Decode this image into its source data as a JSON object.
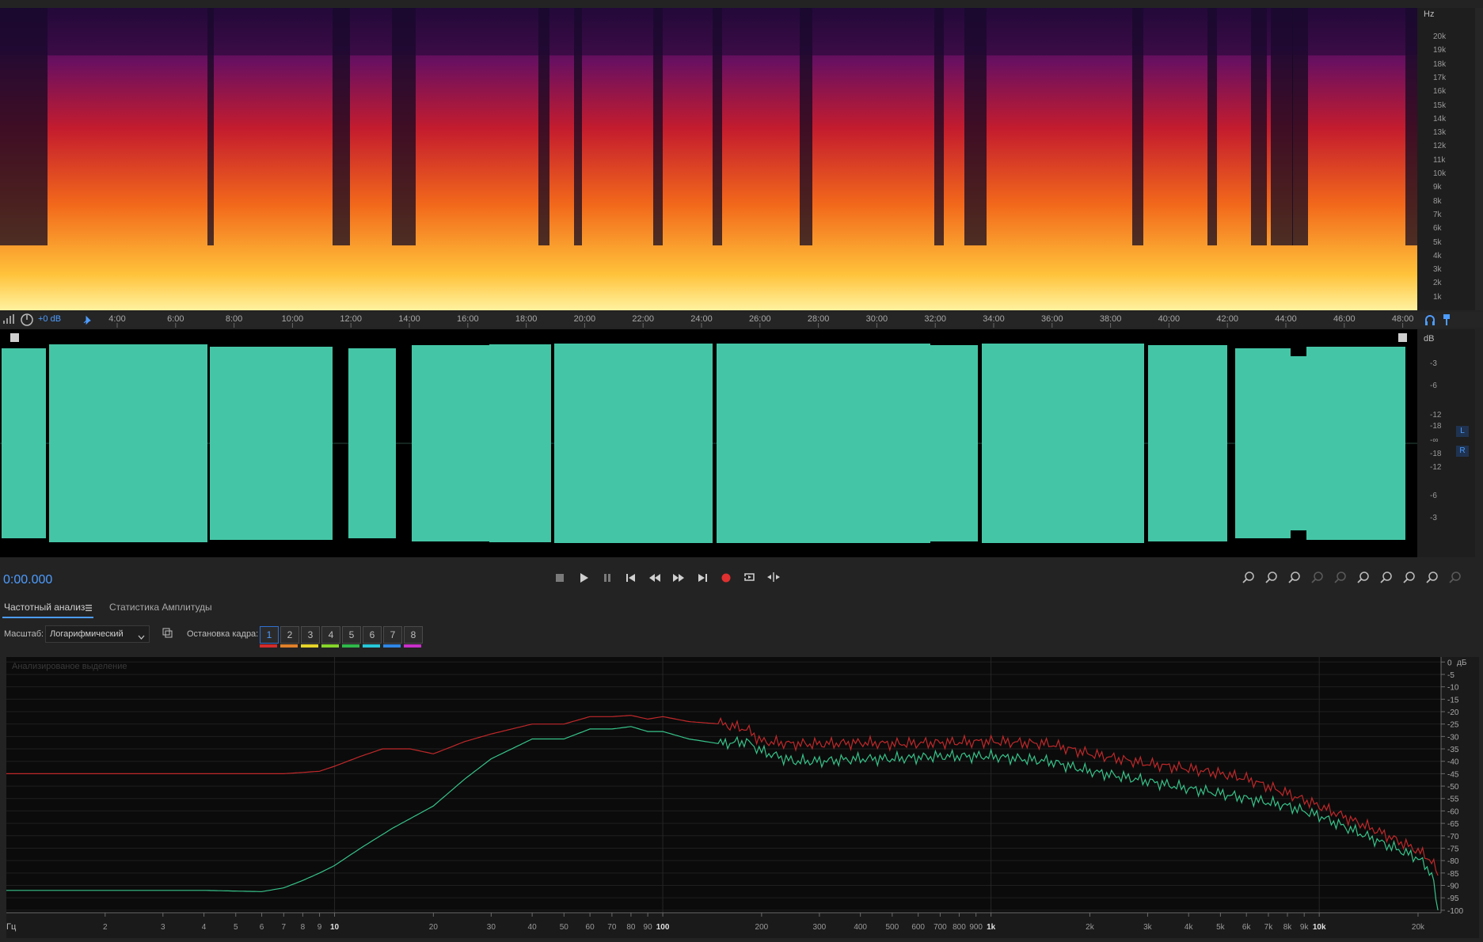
{
  "colors": {
    "waveform": "#44c6a6",
    "analysis_red": "#c0282a",
    "analysis_green": "#37c38a",
    "accent_blue": "#3a8ee6",
    "record_red": "#e03030"
  },
  "spectrogram": {
    "hz_unit": "Hz",
    "freq_labels": [
      "20k",
      "19k",
      "18k",
      "17k",
      "16k",
      "15k",
      "14k",
      "13k",
      "12k",
      "11k",
      "10k",
      "9k",
      "8k",
      "7k",
      "6k",
      "5k",
      "4k",
      "3k",
      "2k",
      "1k"
    ]
  },
  "timeline": {
    "gain_label": "+0 dB",
    "ticks": [
      "4:00",
      "6:00",
      "8:00",
      "10:00",
      "12:00",
      "14:00",
      "16:00",
      "18:00",
      "20:00",
      "22:00",
      "24:00",
      "26:00",
      "28:00",
      "30:00",
      "32:00",
      "34:00",
      "36:00",
      "38:00",
      "40:00",
      "42:00",
      "44:00",
      "46:00",
      "48:00"
    ]
  },
  "waveform": {
    "db_unit": "dB",
    "db_labels": [
      "-3",
      "-6",
      "-12",
      "-18",
      "-∞",
      "-18",
      "-12",
      "-6",
      "-3"
    ],
    "channel_left": "L",
    "channel_right": "R"
  },
  "transport": {
    "time": "0:00.000",
    "buttons": [
      "stop-icon",
      "play-icon",
      "pause-icon",
      "skip-start-icon",
      "rewind-icon",
      "fast-forward-icon",
      "skip-end-icon",
      "record-icon",
      "loop-icon",
      "skip-selection-icon"
    ]
  },
  "panel": {
    "tabs": [
      {
        "label": "Частотный анализ",
        "active": true
      },
      {
        "label": "Статистика Амплитуды",
        "active": false
      }
    ],
    "scale_label": "Масштаб:",
    "scale_value": "Логарифмический",
    "freeze_label": "Остановка кадра:",
    "frames": [
      {
        "label": "1",
        "color": "#d42b2b"
      },
      {
        "label": "2",
        "color": "#e0802a"
      },
      {
        "label": "3",
        "color": "#e6d42a"
      },
      {
        "label": "4",
        "color": "#86d52b"
      },
      {
        "label": "5",
        "color": "#2fb84a"
      },
      {
        "label": "6",
        "color": "#27c8d8"
      },
      {
        "label": "7",
        "color": "#2f86e6"
      },
      {
        "label": "8",
        "color": "#c72fc8"
      }
    ]
  },
  "analysis": {
    "overlay_label": "Анализированое выделение",
    "db_unit": "дБ",
    "db_labels": [
      "0",
      "-5",
      "-10",
      "-15",
      "-20",
      "-25",
      "-30",
      "-35",
      "-40",
      "-45",
      "-50",
      "-55",
      "-60",
      "-65",
      "-70",
      "-75",
      "-80",
      "-85",
      "-90",
      "-95",
      "-100"
    ],
    "hz_unit": "Гц",
    "freq_labels": [
      {
        "f": 2,
        "t": "2"
      },
      {
        "f": 3,
        "t": "3"
      },
      {
        "f": 4,
        "t": "4"
      },
      {
        "f": 5,
        "t": "5"
      },
      {
        "f": 6,
        "t": "6"
      },
      {
        "f": 7,
        "t": "7"
      },
      {
        "f": 8,
        "t": "8"
      },
      {
        "f": 9,
        "t": "9"
      },
      {
        "f": 10,
        "t": "10"
      },
      {
        "f": 20,
        "t": "20"
      },
      {
        "f": 30,
        "t": "30"
      },
      {
        "f": 40,
        "t": "40"
      },
      {
        "f": 50,
        "t": "50"
      },
      {
        "f": 60,
        "t": "60"
      },
      {
        "f": 70,
        "t": "70"
      },
      {
        "f": 80,
        "t": "80"
      },
      {
        "f": 90,
        "t": "90"
      },
      {
        "f": 100,
        "t": "100"
      },
      {
        "f": 200,
        "t": "200"
      },
      {
        "f": 300,
        "t": "300"
      },
      {
        "f": 400,
        "t": "400"
      },
      {
        "f": 500,
        "t": "500"
      },
      {
        "f": 600,
        "t": "600"
      },
      {
        "f": 700,
        "t": "700"
      },
      {
        "f": 800,
        "t": "800"
      },
      {
        "f": 900,
        "t": "900"
      },
      {
        "f": 1000,
        "t": "1k"
      },
      {
        "f": 2000,
        "t": "2k"
      },
      {
        "f": 3000,
        "t": "3k"
      },
      {
        "f": 4000,
        "t": "4k"
      },
      {
        "f": 5000,
        "t": "5k"
      },
      {
        "f": 6000,
        "t": "6k"
      },
      {
        "f": 7000,
        "t": "7k"
      },
      {
        "f": 8000,
        "t": "8k"
      },
      {
        "f": 9000,
        "t": "9k"
      },
      {
        "f": 10000,
        "t": "10k"
      },
      {
        "f": 20000,
        "t": "20k"
      }
    ],
    "series": [
      {
        "color": "#c0282a",
        "points": [
          [
            1,
            -45
          ],
          [
            5,
            -45
          ],
          [
            7,
            -45
          ],
          [
            8,
            -44.5
          ],
          [
            9,
            -44
          ],
          [
            10,
            -42
          ],
          [
            12,
            -38
          ],
          [
            14,
            -35
          ],
          [
            17,
            -35
          ],
          [
            20,
            -37
          ],
          [
            25,
            -32
          ],
          [
            30,
            -29
          ],
          [
            40,
            -25
          ],
          [
            50,
            -25
          ],
          [
            60,
            -22
          ],
          [
            70,
            -22
          ],
          [
            80,
            -21.5
          ],
          [
            90,
            -23
          ],
          [
            100,
            -22
          ],
          [
            120,
            -24
          ],
          [
            150,
            -25
          ],
          [
            180,
            -27
          ],
          [
            200,
            -32
          ],
          [
            250,
            -33
          ],
          [
            300,
            -33
          ],
          [
            400,
            -32.5
          ],
          [
            500,
            -33
          ],
          [
            700,
            -32.5
          ],
          [
            1000,
            -32
          ],
          [
            1500,
            -33
          ],
          [
            2000,
            -37
          ],
          [
            3000,
            -41
          ],
          [
            4000,
            -43
          ],
          [
            5000,
            -45
          ],
          [
            6000,
            -47
          ],
          [
            8000,
            -53
          ],
          [
            10000,
            -58
          ],
          [
            15000,
            -68
          ],
          [
            20000,
            -76
          ],
          [
            22000,
            -80
          ],
          [
            23000,
            -86
          ]
        ]
      },
      {
        "color": "#37c38a",
        "points": [
          [
            1,
            -92
          ],
          [
            4,
            -92
          ],
          [
            6,
            -92.5
          ],
          [
            7,
            -91
          ],
          [
            8,
            -88
          ],
          [
            9,
            -85
          ],
          [
            10,
            -82
          ],
          [
            12,
            -75
          ],
          [
            15,
            -67
          ],
          [
            20,
            -58
          ],
          [
            25,
            -47
          ],
          [
            30,
            -39
          ],
          [
            40,
            -31
          ],
          [
            50,
            -31
          ],
          [
            60,
            -27
          ],
          [
            70,
            -27
          ],
          [
            80,
            -26
          ],
          [
            90,
            -28
          ],
          [
            100,
            -28
          ],
          [
            120,
            -31
          ],
          [
            150,
            -33
          ],
          [
            180,
            -32
          ],
          [
            200,
            -36
          ],
          [
            250,
            -40
          ],
          [
            300,
            -40
          ],
          [
            400,
            -39
          ],
          [
            500,
            -39
          ],
          [
            700,
            -38
          ],
          [
            1000,
            -38
          ],
          [
            1500,
            -40
          ],
          [
            2000,
            -44
          ],
          [
            3000,
            -48
          ],
          [
            4000,
            -51
          ],
          [
            5000,
            -53
          ],
          [
            6000,
            -55
          ],
          [
            8000,
            -58
          ],
          [
            10000,
            -62
          ],
          [
            15000,
            -72
          ],
          [
            20000,
            -79
          ],
          [
            22000,
            -85
          ],
          [
            23000,
            -100
          ]
        ]
      }
    ]
  },
  "zoom_controls": [
    "zoom-in-amplitude-icon",
    "zoom-out-amplitude-icon",
    "zoom-selection-icon",
    "zoom-out-full-icon",
    "zoom-in-time-icon",
    "zoom-out-time-icon",
    "zoom-in-to-playhead-icon",
    "zoom-out-wide-icon",
    "zoom-reset-icon",
    "zoom-settings-icon"
  ]
}
